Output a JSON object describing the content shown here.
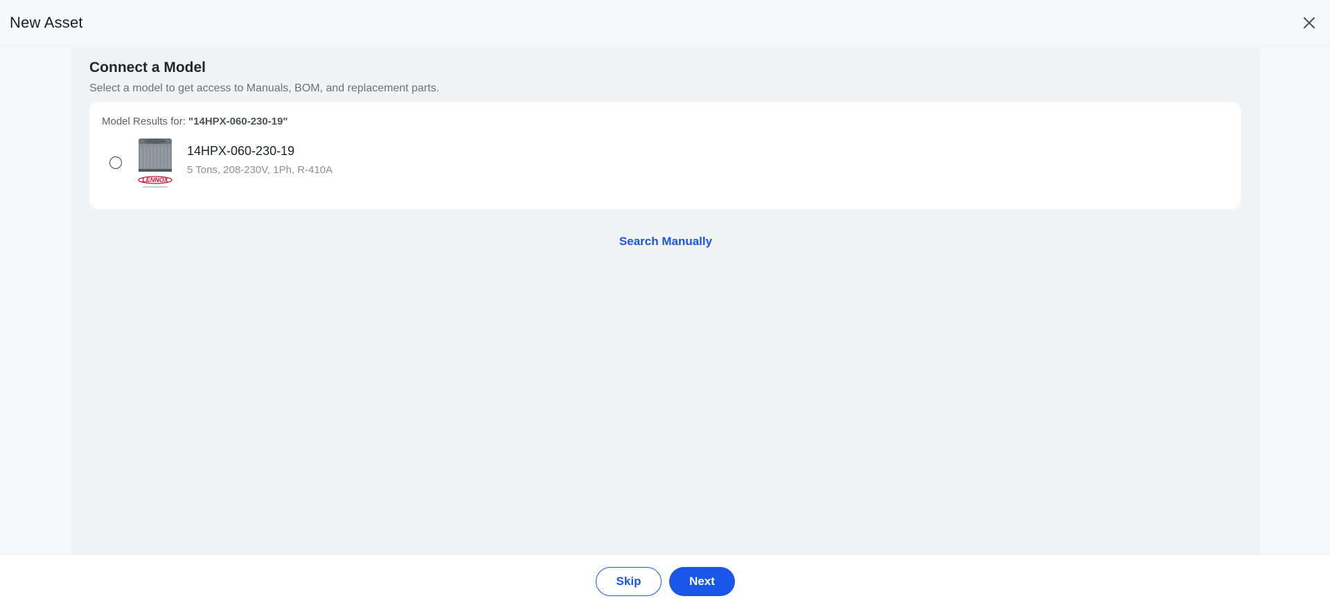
{
  "header": {
    "title": "New Asset",
    "close_icon": "close-icon"
  },
  "connect": {
    "title": "Connect a Model",
    "subtitle": "Select a model to get access to Manuals, BOM, and replacement parts."
  },
  "results": {
    "label_prefix": "Model Results for: ",
    "query": "\"14HPX-060-230-19\"",
    "models": [
      {
        "name": "14HPX-060-230-19",
        "specs": "5 Tons, 208-230V, 1Ph, R-410A",
        "brand": "LENNOX",
        "selected": false
      }
    ]
  },
  "search_manually_label": "Search Manually",
  "footer": {
    "skip_label": "Skip",
    "next_label": "Next"
  },
  "colors": {
    "accent": "#1a56e8",
    "brand_red": "#c8102e"
  }
}
